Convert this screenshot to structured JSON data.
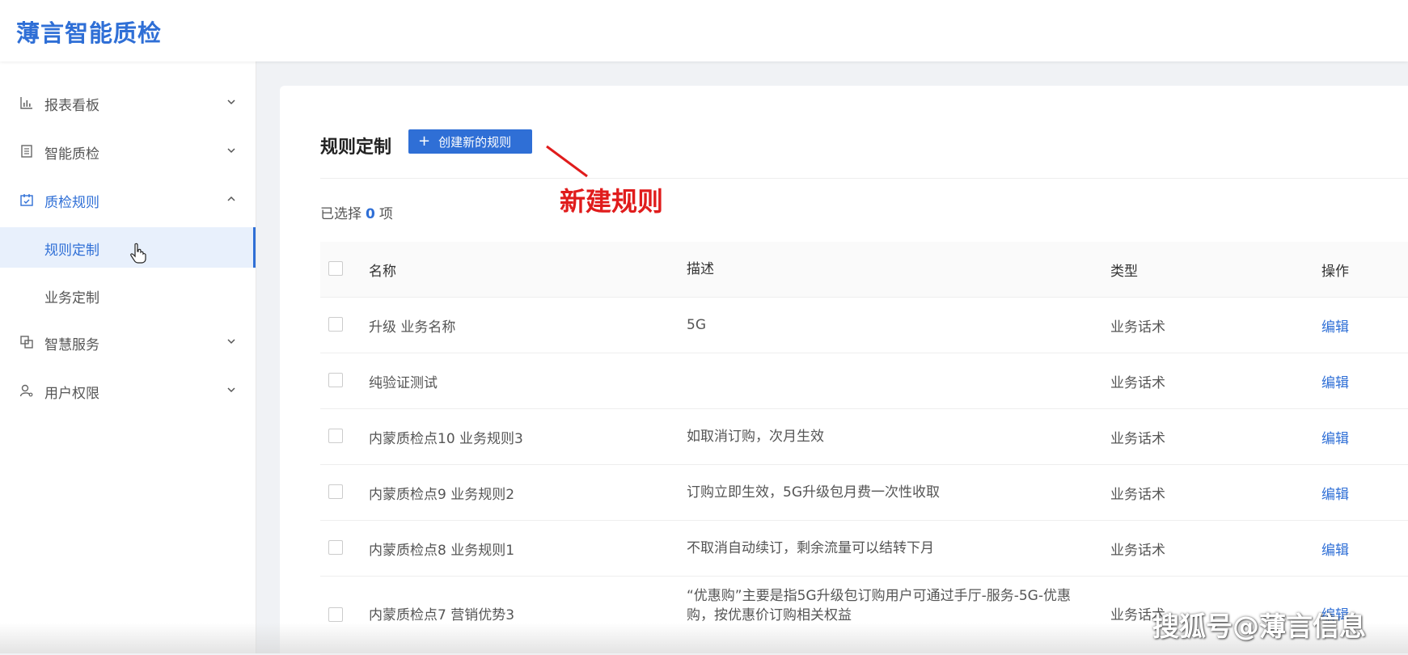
{
  "header": {
    "brand": "薄言智能质检"
  },
  "sidebar": {
    "items": [
      {
        "label": "报表看板",
        "icon": "bar-chart-icon"
      },
      {
        "label": "智能质检",
        "icon": "document-icon"
      },
      {
        "label": "质检规则",
        "icon": "calendar-check-icon",
        "open": true,
        "children": [
          {
            "label": "规则定制",
            "active": true
          },
          {
            "label": "业务定制"
          }
        ]
      },
      {
        "label": "智慧服务",
        "icon": "copy-icon"
      },
      {
        "label": "用户权限",
        "icon": "user-key-icon"
      }
    ]
  },
  "main": {
    "title": "规则定制",
    "create_button": "创建新的规则",
    "annotation": "新建规则",
    "selected": {
      "prefix": "已选择",
      "count": "0",
      "suffix": "项"
    },
    "table": {
      "columns": {
        "name": "名称",
        "desc": "描述",
        "type": "类型",
        "op": "操作"
      },
      "rows": [
        {
          "name": "升级 业务名称",
          "desc": "5G",
          "type": "业务话术",
          "op": "编辑"
        },
        {
          "name": "纯验证测试",
          "desc": "",
          "type": "业务话术",
          "op": "编辑"
        },
        {
          "name": "内蒙质检点10 业务规则3",
          "desc": "如取消订购，次月生效",
          "type": "业务话术",
          "op": "编辑"
        },
        {
          "name": "内蒙质检点9 业务规则2",
          "desc": "订购立即生效，5G升级包月费一次性收取",
          "type": "业务话术",
          "op": "编辑"
        },
        {
          "name": "内蒙质检点8 业务规则1",
          "desc": "不取消自动续订，剩余流量可以结转下月",
          "type": "业务话术",
          "op": "编辑"
        },
        {
          "name": "内蒙质检点7 营销优势3",
          "desc": "“优惠购”主要是指5G升级包订购用户可通过手厅-服务-5G-优惠购，按优惠价订购相关权益",
          "type": "业务话术",
          "op": "编辑"
        }
      ]
    }
  },
  "watermark": "搜狐号@薄言信息",
  "colors": {
    "primary": "#2f6fd6",
    "annotation": "#e01c1c"
  }
}
